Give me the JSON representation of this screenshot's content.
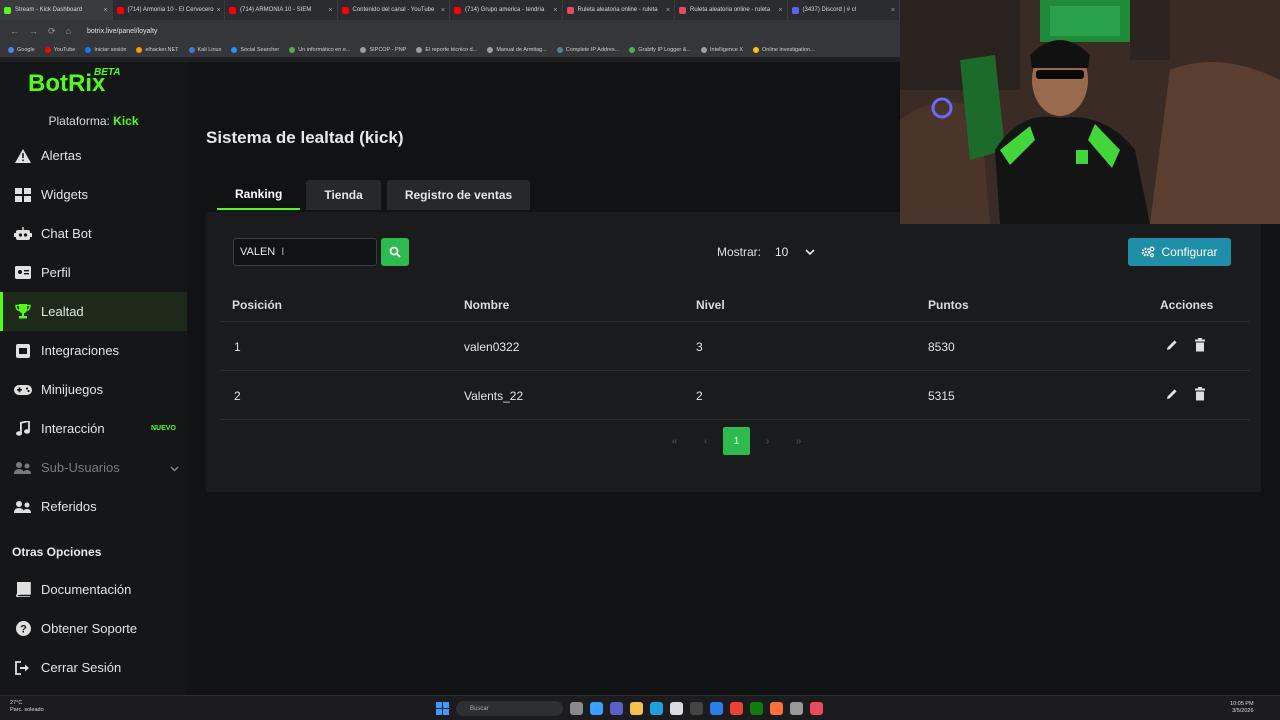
{
  "browser": {
    "tabs": [
      {
        "label": "Stream - Kick Dashboard",
        "color": "#53fc18"
      },
      {
        "label": "(714) Armonia 10 - El Cervecero",
        "color": "#ff0000"
      },
      {
        "label": "(714) ARMONIA 10 - SIEM",
        "color": "#ff0000"
      },
      {
        "label": "Contenido del canal - YouTube",
        "color": "#ff0000"
      },
      {
        "label": "(714) Grupo america - tendría",
        "color": "#ff0000"
      },
      {
        "label": "Ruleta aleatoria online - ruleta",
        "color": "#e84a5f"
      },
      {
        "label": "Ruleta aleatoria online - ruleta",
        "color": "#e84a5f"
      },
      {
        "label": "(3437) Discord | # cl",
        "color": "#5865f2"
      }
    ],
    "url": "botrix.live/panel/loyalty",
    "bookmarks": [
      {
        "label": "Google",
        "color": "#4285f4"
      },
      {
        "label": "YouTube",
        "color": "#ff0000"
      },
      {
        "label": "Iniciar sesión",
        "color": "#1877f2"
      },
      {
        "label": "elhacker.NET",
        "color": "#ff9800"
      },
      {
        "label": "Kali Linux",
        "color": "#3a7bd5"
      },
      {
        "label": "Social Searcher",
        "color": "#2c8ef8"
      },
      {
        "label": "Un informático en e...",
        "color": "#4caf50"
      },
      {
        "label": "SIPCOP - PNP",
        "color": "#9e9e9e"
      },
      {
        "label": "El reporte técnico d...",
        "color": "#9e9e9e"
      },
      {
        "label": "Manual de Armitag...",
        "color": "#9e9e9e"
      },
      {
        "label": "Complete IP Addres...",
        "color": "#607d8b"
      },
      {
        "label": "Grabify IP Logger &...",
        "color": "#4caf50"
      },
      {
        "label": "Intelligence X",
        "color": "#9e9e9e"
      },
      {
        "label": "Online investigation...",
        "color": "#ffc107"
      }
    ]
  },
  "app": {
    "logo": "BotRix",
    "logo_badge": "BETA",
    "platform_label": "Plataforma:",
    "platform_value": "Kick",
    "accent": "#53fc18",
    "menu": [
      {
        "label": "Alertas",
        "icon": "exclamation-triangle-icon"
      },
      {
        "label": "Widgets",
        "icon": "grid-icon"
      },
      {
        "label": "Chat Bot",
        "icon": "robot-icon"
      },
      {
        "label": "Perfil",
        "icon": "id-card-icon"
      },
      {
        "label": "Lealtad",
        "icon": "trophy-icon",
        "active": true
      },
      {
        "label": "Integraciones",
        "icon": "plug-icon"
      },
      {
        "label": "Minijuegos",
        "icon": "gamepad-icon"
      },
      {
        "label": "Interacción",
        "icon": "music-icon",
        "badge": "NUEVO"
      },
      {
        "label": "Sub-Usuarios",
        "icon": "users-cog-icon",
        "muted": true
      },
      {
        "label": "Referidos",
        "icon": "users-icon"
      }
    ],
    "other_title": "Otras Opciones",
    "other_menu": [
      {
        "label": "Documentación",
        "icon": "book-icon"
      },
      {
        "label": "Obtener Soporte",
        "icon": "question-icon"
      },
      {
        "label": "Cerrar Sesión",
        "icon": "sign-out-icon"
      }
    ]
  },
  "page": {
    "title": "Sistema de lealtad (kick)",
    "tabs": [
      "Ranking",
      "Tienda",
      "Registro de ventas"
    ],
    "active_tab": 0,
    "search_value": "VALEN",
    "show_label": "Mostrar:",
    "show_value": "10",
    "configure_label": "Configurar",
    "columns": [
      "Posición",
      "Nombre",
      "Nivel",
      "Puntos",
      "Acciones"
    ],
    "rows": [
      {
        "pos": "1",
        "name": "valen0322",
        "level": "3",
        "points": "8530"
      },
      {
        "pos": "2",
        "name": "Valents_22",
        "level": "2",
        "points": "5315"
      }
    ],
    "pager": {
      "first": "«",
      "prev": "‹",
      "current": "1",
      "next": "›",
      "last": "»"
    }
  },
  "taskbar": {
    "temp": "27°C",
    "weather": "Parc. soleado",
    "search_placeholder": "Buscar",
    "time": "10:05 PM",
    "date": "3/5/2026"
  }
}
